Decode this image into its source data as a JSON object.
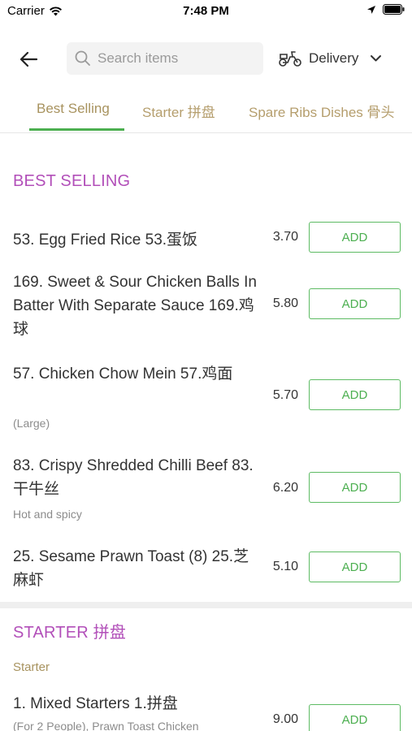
{
  "status_bar": {
    "carrier": "Carrier",
    "time": "7:48 PM"
  },
  "header": {
    "search_placeholder": "Search items",
    "delivery_label": "Delivery"
  },
  "tabs": [
    {
      "label": "Best Selling"
    },
    {
      "label": "Starter 拼盘"
    },
    {
      "label": "Spare Ribs Dishes 骨头"
    }
  ],
  "sections": [
    {
      "title": "BEST SELLING",
      "items": [
        {
          "name": "53. Egg Fried Rice 53.蛋饭",
          "description": "",
          "price": "3.70",
          "button": "ADD"
        },
        {
          "name": "169. Sweet & Sour Chicken Balls In Batter With Separate Sauce 169.鸡球",
          "description": "",
          "price": "5.80",
          "button": "ADD"
        },
        {
          "name": "57. Chicken Chow Mein 57.鸡面",
          "description": "(Large)",
          "price": "5.70",
          "button": "ADD"
        },
        {
          "name": "83. Crispy Shredded Chilli Beef 83.干牛丝",
          "description": "Hot and spicy",
          "price": "6.20",
          "button": "ADD"
        },
        {
          "name": "25. Sesame Prawn Toast (8) 25.芝麻虾",
          "description": "",
          "price": "5.10",
          "button": "ADD"
        }
      ]
    },
    {
      "title": "STARTER 拼盘",
      "subtitle": "Starter",
      "items": [
        {
          "name": "1. Mixed Starters 1.拼盘",
          "description": "(For 2 People), Prawn Toast Chicken",
          "price": "9.00",
          "button": "ADD"
        }
      ]
    }
  ],
  "colors": {
    "accent_green": "#4caf50",
    "section_purple": "#b24fb9",
    "tab_gold": "#a8935f"
  }
}
